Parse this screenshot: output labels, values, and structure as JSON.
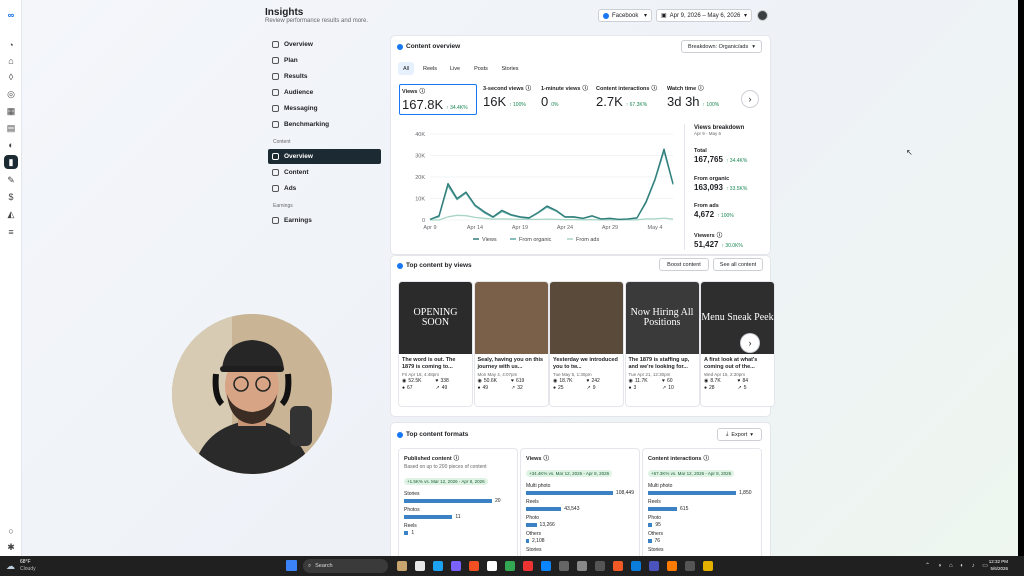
{
  "header": {
    "title": "Insights",
    "subtitle": "Review performance results and more."
  },
  "controls": {
    "platform": "Facebook",
    "date_range": "Apr 9, 2026 – May 6, 2026"
  },
  "nav": {
    "items": [
      "Overview",
      "Plan",
      "Results",
      "Audience",
      "Messaging",
      "Benchmarking"
    ],
    "section_content": "Content",
    "content_items": [
      "Overview",
      "Content",
      "Ads"
    ],
    "section_earnings": "Earnings",
    "earnings_items": [
      "Earnings"
    ]
  },
  "overview": {
    "title": "Content overview",
    "breakdown_select": "Breakdown: Organic/ads",
    "tabs": [
      "All",
      "Reels",
      "Live",
      "Posts",
      "Stories"
    ],
    "metrics": [
      {
        "label": "Views",
        "value": "167.8K",
        "delta": "↑ 34.4K%"
      },
      {
        "label": "3-second views",
        "value": "16K",
        "delta": "↑ 100%"
      },
      {
        "label": "1-minute views",
        "value": "0",
        "delta": "0%"
      },
      {
        "label": "Content interactions",
        "value": "2.7K",
        "delta": "↑ 67.3K%"
      },
      {
        "label": "Watch time",
        "value": "3d 3h",
        "delta": "↑ 100%"
      }
    ],
    "breakdown": {
      "title": "Views breakdown",
      "range": "Apr 9 - May 6",
      "rows": [
        {
          "label": "Total",
          "value": "167,765",
          "delta": "↑ 34.4K%"
        },
        {
          "label": "From organic",
          "value": "163,093",
          "delta": "↑ 33.5K%"
        },
        {
          "label": "From ads",
          "value": "4,672",
          "delta": "↑ 100%"
        },
        {
          "label": "Viewers",
          "value": "51,427",
          "delta": "↑ 30.0K%"
        }
      ]
    }
  },
  "chart_data": {
    "type": "line",
    "x": [
      "Apr 9",
      "Apr 10",
      "Apr 11",
      "Apr 12",
      "Apr 13",
      "Apr 14",
      "Apr 15",
      "Apr 16",
      "Apr 17",
      "Apr 18",
      "Apr 19",
      "Apr 20",
      "Apr 21",
      "Apr 22",
      "Apr 23",
      "Apr 24",
      "Apr 25",
      "Apr 26",
      "Apr 27",
      "Apr 28",
      "Apr 29",
      "Apr 30",
      "May 1",
      "May 2",
      "May 3",
      "May 4",
      "May 5",
      "May 6"
    ],
    "x_ticks": [
      "Apr 9",
      "Apr 14",
      "Apr 19",
      "Apr 24",
      "Apr 29",
      "May 4"
    ],
    "y_ticks": [
      "0",
      "10K",
      "20K",
      "30K",
      "40K"
    ],
    "ylim": [
      0,
      40000
    ],
    "series": [
      {
        "name": "Views",
        "color": "#2f7d7a",
        "values": [
          300,
          2000,
          17000,
          10000,
          13000,
          7000,
          4000,
          1500,
          4500,
          2500,
          1500,
          1000,
          3500,
          6500,
          4500,
          1500,
          1500,
          800,
          2000,
          500,
          800,
          300,
          500,
          1000,
          8500,
          19000,
          33000,
          17000
        ]
      },
      {
        "name": "From organic",
        "color": "#5fa8a4",
        "values": [
          300,
          1500,
          16000,
          9500,
          12500,
          6500,
          3500,
          1200,
          4000,
          2200,
          1200,
          800,
          3200,
          6000,
          4200,
          1300,
          1200,
          700,
          1700,
          400,
          700,
          300,
          400,
          900,
          8000,
          18500,
          32000,
          16500
        ]
      },
      {
        "name": "From ads",
        "color": "#a8d5c4",
        "values": [
          0,
          0,
          1500,
          2200,
          2000,
          1200,
          800,
          400,
          500,
          400,
          300,
          300,
          300,
          400,
          300,
          200,
          200,
          100,
          200,
          100,
          100,
          0,
          100,
          100,
          500,
          500,
          900,
          400
        ]
      }
    ],
    "grid": true,
    "legend": "bottom"
  },
  "top_content": {
    "title": "Top content by views",
    "boost_label": "Boost content",
    "see_all_label": "See all content",
    "items": [
      {
        "image_text": "OPENING SOON",
        "caption": "The word is out. The 1879 is coming to...",
        "date": "Fri Apr 18, 4:48pm",
        "views": "52.5K",
        "reactions": "338",
        "comments": "67",
        "shares": "49",
        "bg": "#2b2b2b"
      },
      {
        "image_text": "",
        "caption": "Sealy, having you on this journey with us...",
        "date": "Mon May 4, 4:07pm",
        "views": "50.6K",
        "reactions": "619",
        "comments": "49",
        "shares": "32",
        "bg": "#7a6048"
      },
      {
        "image_text": "",
        "caption": "Yesterday we introduced you to tw...",
        "date": "Tue May 5, 1:30pm",
        "views": "18.7K",
        "reactions": "242",
        "comments": "25",
        "shares": "9",
        "bg": "#5a4a3a"
      },
      {
        "image_text": "Now Hiring All Positions",
        "caption": "The 1879 is staffing up, and we're looking for...",
        "date": "Tue Apr 21, 12:30pm",
        "views": "11.7K",
        "reactions": "60",
        "comments": "3",
        "shares": "10",
        "bg": "#3a3a3a"
      },
      {
        "image_text": "Menu Sneak Peek",
        "caption": "A first look at what's coming out of the...",
        "date": "Wed Apr 15, 2:30pm",
        "views": "8.7K",
        "reactions": "84",
        "comments": "28",
        "shares": "5",
        "bg": "#2e2e2e"
      }
    ]
  },
  "formats": {
    "title": "Top content formats",
    "export_label": "Export",
    "columns": [
      {
        "title": "Published content",
        "sub": "Based on up to 200 pieces of content",
        "badge": "+1.5K% vs. Mar 12, 2026 - Apr 8, 2026",
        "rows": [
          {
            "label": "Stories",
            "value": "20",
            "frac": 1.0
          },
          {
            "label": "Photos",
            "value": "11",
            "frac": 0.55
          },
          {
            "label": "Reels",
            "value": "1",
            "frac": 0.05
          }
        ]
      },
      {
        "title": "Views",
        "sub": "",
        "badge": "+34.4K% vs. Mar 12, 2026 - Apr 8, 2026",
        "rows": [
          {
            "label": "Multi photo",
            "value": "108,449",
            "frac": 1.0
          },
          {
            "label": "Reels",
            "value": "43,543",
            "frac": 0.4
          },
          {
            "label": "Photo",
            "value": "13,266",
            "frac": 0.12
          },
          {
            "label": "Others",
            "value": "2,108",
            "frac": 0.02
          },
          {
            "label": "Stories",
            "value": "",
            "frac": 0
          }
        ]
      },
      {
        "title": "Content interactions",
        "sub": "",
        "badge": "+67.3K% vs. Mar 12, 2026 - Apr 8, 2026",
        "rows": [
          {
            "label": "Multi photo",
            "value": "1,850",
            "frac": 1.0
          },
          {
            "label": "Reels",
            "value": "615",
            "frac": 0.33
          },
          {
            "label": "Photo",
            "value": "95",
            "frac": 0.05
          },
          {
            "label": "Others",
            "value": "76",
            "frac": 0.04
          },
          {
            "label": "Stories",
            "value": "",
            "frac": 0
          }
        ]
      }
    ]
  },
  "taskbar": {
    "weather_temp": "68°F",
    "weather_desc": "Cloudy",
    "search_placeholder": "Search",
    "time": "12:32 PM",
    "date": "5/6/2026"
  }
}
